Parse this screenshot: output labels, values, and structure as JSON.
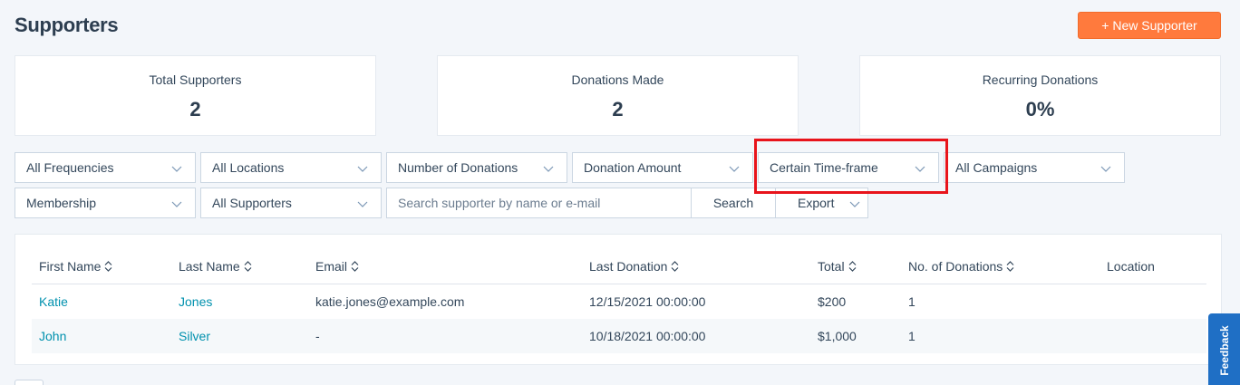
{
  "header": {
    "title": "Supporters",
    "new_button_label": "+ New Supporter"
  },
  "stats": [
    {
      "label": "Total Supporters",
      "value": "2"
    },
    {
      "label": "Donations Made",
      "value": "2"
    },
    {
      "label": "Recurring Donations",
      "value": "0%"
    }
  ],
  "filters": {
    "frequency": "All Frequencies",
    "location": "All Locations",
    "donation_count": "Number of Donations",
    "donation_amount": "Donation Amount",
    "time_frame": "Certain Time-frame",
    "campaigns": "All Campaigns",
    "membership": "Membership",
    "supporters": "All Supporters"
  },
  "search": {
    "placeholder": "Search supporter by name or e-mail",
    "button_label": "Search",
    "export_label": "Export"
  },
  "table": {
    "columns": [
      "First Name",
      "Last Name",
      "Email",
      "Last Donation",
      "Total",
      "No. of Donations",
      "Location"
    ],
    "rows": [
      {
        "first_name": "Katie",
        "last_name": "Jones",
        "email": "katie.jones@example.com",
        "last_donation": "12/15/2021 00:00:00",
        "total": "$200",
        "donations": "1",
        "location": ""
      },
      {
        "first_name": "John",
        "last_name": "Silver",
        "email": "-",
        "last_donation": "10/18/2021 00:00:00",
        "total": "$1,000",
        "donations": "1",
        "location": ""
      }
    ]
  },
  "feedback": {
    "label": "Feedback"
  },
  "colors": {
    "accent": "#ff7a3d",
    "link": "#0091ae",
    "highlight": "#e8141b",
    "feedback": "#1f6fc5"
  }
}
